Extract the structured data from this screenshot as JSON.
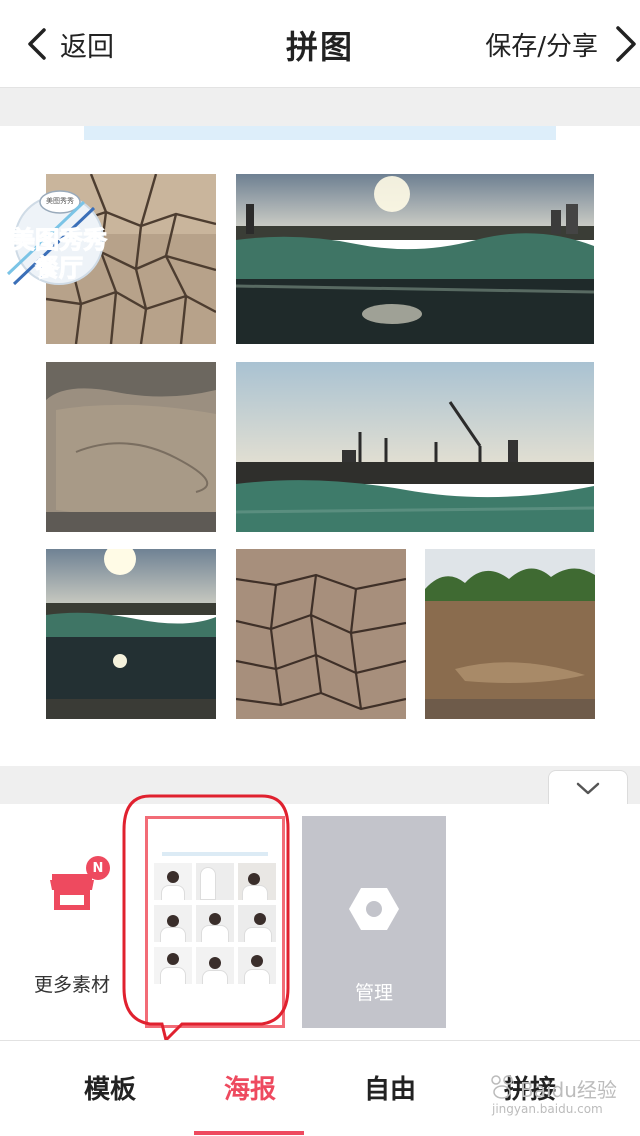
{
  "header": {
    "back_label": "返回",
    "title": "拼图",
    "save_label": "保存/分享"
  },
  "sticker": {
    "text": "美图秀秀餐厅",
    "badge_text": "美图秀秀"
  },
  "photos": [
    {
      "name": "photo-cracked-earth-1",
      "scene": "cracked-mud"
    },
    {
      "name": "photo-construction-sunset-1",
      "scene": "construction-sunset"
    },
    {
      "name": "photo-mud-puddle",
      "scene": "mud"
    },
    {
      "name": "photo-construction-cranes",
      "scene": "construction-cranes"
    },
    {
      "name": "photo-water-sunset",
      "scene": "water-sunset"
    },
    {
      "name": "photo-cracked-earth-2",
      "scene": "cracked-mud"
    },
    {
      "name": "photo-river-trees",
      "scene": "river"
    }
  ],
  "panel": {
    "more_materials_label": "更多素材",
    "badge": "N",
    "manage_label": "管理"
  },
  "tabs": [
    {
      "label": "模板",
      "active": false
    },
    {
      "label": "海报",
      "active": true
    },
    {
      "label": "自由",
      "active": false
    },
    {
      "label": "拼接",
      "active": false
    }
  ],
  "watermark": {
    "title": "Baidu经验",
    "url": "jingyan.baidu.com"
  },
  "colors": {
    "accent": "#ee4a5f",
    "annotation": "#e0212f",
    "manage_bg": "#c3c4cb"
  }
}
